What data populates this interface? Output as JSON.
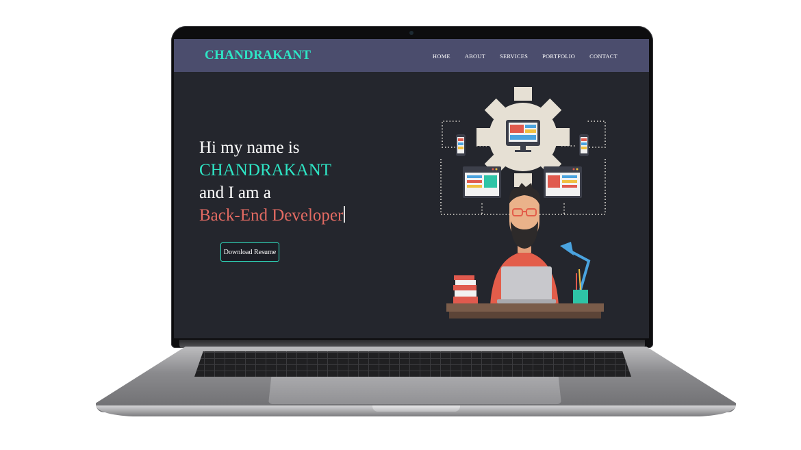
{
  "site": {
    "brand": "CHANDRAKANT",
    "nav": [
      "HOME",
      "ABOUT",
      "SERVICES",
      "PORTFOLIO",
      "CONTACT"
    ]
  },
  "hero": {
    "line1": "Hi my name is",
    "name": "CHANDRAKANT",
    "line3": "and I am a",
    "role": "Back-End Developer",
    "button_label": "Download Resume"
  },
  "colors": {
    "accent": "#2ee5c5",
    "role": "#e26a62",
    "navbar": "#4b4d6d",
    "background": "#24262d"
  },
  "illustration": {
    "icons": [
      "gear-icon",
      "monitor-icon",
      "phone-icon",
      "browser-window-icon",
      "developer-avatar",
      "laptop-icon",
      "desk-lamp-icon",
      "books-icon"
    ]
  }
}
